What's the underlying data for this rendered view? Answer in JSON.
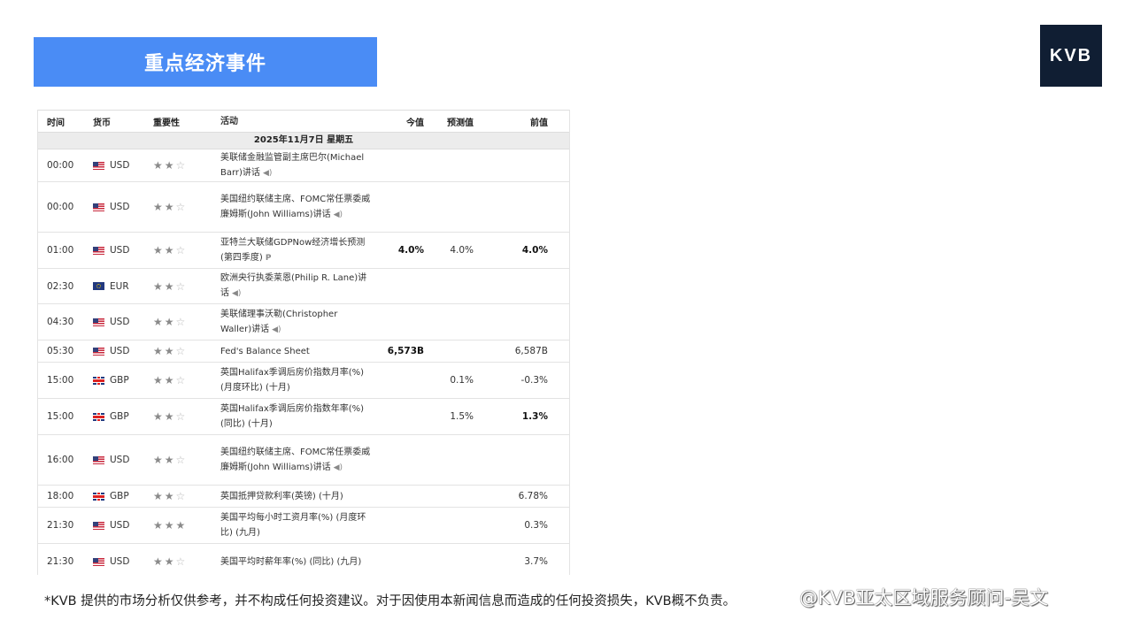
{
  "header": {
    "title": "重点经济事件",
    "logo_text": "KVB"
  },
  "table": {
    "columns": {
      "time": "时间",
      "currency": "货币",
      "importance": "重要性",
      "event": "活动",
      "actual": "今值",
      "forecast": "预测值",
      "previous": "前值"
    },
    "date": "2025年11月7日 星期五",
    "rows": [
      {
        "time": "00:00",
        "flag": "us",
        "currency": "USD",
        "stars": 2,
        "event": "美联储金融监管副主席巴尔(Michael Barr)讲话",
        "speaker": true,
        "actual": "",
        "forecast": "",
        "previous": ""
      },
      {
        "time": "00:00",
        "flag": "us",
        "currency": "USD",
        "stars": 2,
        "event": "美国纽约联储主席、FOMC常任票委威廉姆斯(John Williams)讲话",
        "speaker": true,
        "actual": "",
        "forecast": "",
        "previous": ""
      },
      {
        "time": "01:00",
        "flag": "us",
        "currency": "USD",
        "stars": 2,
        "event": "亚特兰大联储GDPNow经济增长预测 (第四季度)",
        "prelim": "P",
        "actual": "4.0%",
        "forecast": "4.0%",
        "previous": "4.0%",
        "previous_bold": true
      },
      {
        "time": "02:30",
        "flag": "eu",
        "currency": "EUR",
        "stars": 2,
        "event": "欧洲央行执委莱恩(Philip R. Lane)讲话",
        "speaker": true,
        "actual": "",
        "forecast": "",
        "previous": ""
      },
      {
        "time": "04:30",
        "flag": "us",
        "currency": "USD",
        "stars": 2,
        "event": "美联储理事沃勒(Christopher Waller)讲话",
        "speaker": true,
        "actual": "",
        "forecast": "",
        "previous": ""
      },
      {
        "time": "05:30",
        "flag": "us",
        "currency": "USD",
        "stars": 2,
        "event": "Fed's Balance Sheet",
        "actual": "6,573B",
        "forecast": "",
        "previous": "6,587B"
      },
      {
        "time": "15:00",
        "flag": "gb",
        "currency": "GBP",
        "stars": 2,
        "event": "英国Halifax季调后房价指数月率(%) (月度环比) (十月)",
        "actual": "",
        "forecast": "0.1%",
        "previous": "-0.3%"
      },
      {
        "time": "15:00",
        "flag": "gb",
        "currency": "GBP",
        "stars": 2,
        "event": "英国Halifax季调后房价指数年率(%) (同比) (十月)",
        "actual": "",
        "forecast": "1.5%",
        "previous": "1.3%",
        "previous_bold": true
      },
      {
        "time": "16:00",
        "flag": "us",
        "currency": "USD",
        "stars": 2,
        "event": "美国纽约联储主席、FOMC常任票委威廉姆斯(John Williams)讲话",
        "speaker": true,
        "actual": "",
        "forecast": "",
        "previous": ""
      },
      {
        "time": "18:00",
        "flag": "gb",
        "currency": "GBP",
        "stars": 2,
        "event": "英国抵押贷款利率(英镑) (十月)",
        "actual": "",
        "forecast": "",
        "previous": "6.78%"
      },
      {
        "time": "21:30",
        "flag": "us",
        "currency": "USD",
        "stars": 3,
        "event": "美国平均每小时工资月率(%) (月度环比) (九月)",
        "actual": "",
        "forecast": "",
        "previous": "0.3%"
      },
      {
        "time": "21:30",
        "flag": "us",
        "currency": "USD",
        "stars": 2,
        "event": "美国平均时薪年率(%) (同比) (九月)",
        "actual": "",
        "forecast": "",
        "previous": "3.7%"
      }
    ]
  },
  "footer": {
    "disclaimer": "*KVB 提供的市场分析仅供参考，并不构成任何投资建议。对于因使用本新闻信息而造成的任何投资损失，KVB概不负责。",
    "watermark": "@KVB亚太区域服务顾问-吴文"
  },
  "colors": {
    "title_bar": "#4a8cf5",
    "logo_bg": "#101e33"
  }
}
